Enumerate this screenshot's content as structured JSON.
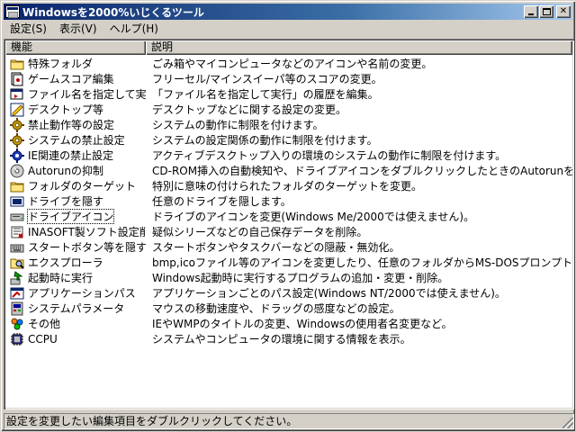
{
  "window": {
    "title": "Windowsを2000%いじくるツール"
  },
  "menu": [
    {
      "label": "設定(S)"
    },
    {
      "label": "表示(V)"
    },
    {
      "label": "ヘルプ(H)"
    }
  ],
  "list": {
    "columns": [
      "機能",
      "説明"
    ],
    "rows": [
      {
        "name": "特殊フォルダ",
        "desc": "ごみ箱やマイコンピュータなどのアイコンや名前の変更。",
        "icon": "folder-icon"
      },
      {
        "name": "ゲームスコア編集",
        "desc": "フリーセル/マインスイーパ等のスコアの変更。",
        "icon": "cards-icon"
      },
      {
        "name": "ファイル名を指定して実行",
        "desc": "「ファイル名を指定して実行」の履歴を編集。",
        "icon": "run-icon"
      },
      {
        "name": "デスクトップ等",
        "desc": "デスクトップなどに関する設定の変更。",
        "icon": "desktop-icon"
      },
      {
        "name": "禁止動作等の設定",
        "desc": "システムの動作に制限を付けます。",
        "icon": "gear-icon"
      },
      {
        "name": "システムの禁止設定",
        "desc": "システムの設定関係の動作に制限を付けます。",
        "icon": "gear-icon"
      },
      {
        "name": "IE関連の禁止設定",
        "desc": "アクティブデスクトップ入りの環境のシステムの動作に制限を付けます。",
        "icon": "gear-ie-icon"
      },
      {
        "name": "Autorunの抑制",
        "desc": "CD-ROM挿入の自動検知や、ドライブアイコンをダブルクリックしたときのAutorunを抑制。",
        "icon": "cd-icon"
      },
      {
        "name": "フォルダのターゲット",
        "desc": "特別に意味の付けられたフォルダのターゲットを変更。",
        "icon": "folder-icon"
      },
      {
        "name": "ドライブを隠す",
        "desc": "任意のドライブを隠します。",
        "icon": "drive-hide-icon"
      },
      {
        "name": "ドライブアイコン",
        "desc": "ドライブのアイコンを変更(Windows Me/2000では使えません)。",
        "icon": "drive-icon"
      },
      {
        "name": "INASOFT製ソフト設定削除",
        "desc": "疑似シリーズなどの自己保存データを削除。",
        "icon": "inasoft-icon"
      },
      {
        "name": "スタートボタン等を隠す",
        "desc": "スタートボタンやタスクバーなどの隠蔽・無効化。",
        "icon": "keyboard-icon"
      },
      {
        "name": "エクスプローラ",
        "desc": "bmp,icoファイル等のアイコンを変更したり、任意のフォルダからMS-DOSプロンプトを起動できるようにします。",
        "icon": "explorer-icon"
      },
      {
        "name": "起動時に実行",
        "desc": "Windows起動時に実行するプログラムの追加・変更・削除。",
        "icon": "startup-icon"
      },
      {
        "name": "アプリケーションパス",
        "desc": "アプリケーションごとのパス設定(Windows NT/2000では使えません)。",
        "icon": "app-path-icon"
      },
      {
        "name": "システムパラメータ",
        "desc": "マウスの移動速度や、ドラッグの感度などの設定。",
        "icon": "system-params-icon"
      },
      {
        "name": "その他",
        "desc": "IEやWMPのタイトルの変更、Windowsの使用者名変更など。",
        "icon": "misc-icon"
      },
      {
        "name": "CCPU",
        "desc": "システムやコンピュータの環境に関する情報を表示。",
        "icon": "cpu-icon"
      }
    ]
  },
  "status": {
    "text": "設定を変更したい編集項目をダブルクリックしてください。"
  }
}
